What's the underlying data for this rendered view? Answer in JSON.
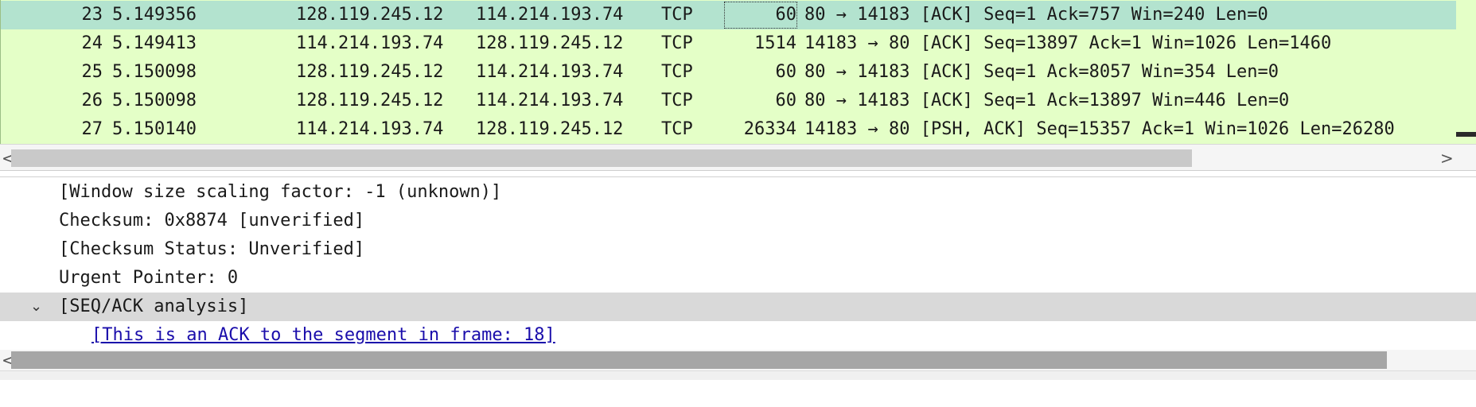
{
  "packet_list": {
    "rows": [
      {
        "no": "23",
        "time": "5.149356",
        "source": "128.119.245.12",
        "destination": "114.214.193.74",
        "protocol": "TCP",
        "length": "60",
        "info": "80 → 14183 [ACK] Seq=1 Ack=757 Win=240 Len=0",
        "selected": true
      },
      {
        "no": "24",
        "time": "5.149413",
        "source": "114.214.193.74",
        "destination": "128.119.245.12",
        "protocol": "TCP",
        "length": "1514",
        "info": "14183 → 80 [ACK] Seq=13897 Ack=1 Win=1026 Len=1460",
        "selected": false
      },
      {
        "no": "25",
        "time": "5.150098",
        "source": "128.119.245.12",
        "destination": "114.214.193.74",
        "protocol": "TCP",
        "length": "60",
        "info": "80 → 14183 [ACK] Seq=1 Ack=8057 Win=354 Len=0",
        "selected": false
      },
      {
        "no": "26",
        "time": "5.150098",
        "source": "128.119.245.12",
        "destination": "114.214.193.74",
        "protocol": "TCP",
        "length": "60",
        "info": "80 → 14183 [ACK] Seq=1 Ack=13897 Win=446 Len=0",
        "selected": false
      },
      {
        "no": "27",
        "time": "5.150140",
        "source": "114.214.193.74",
        "destination": "128.119.245.12",
        "protocol": "TCP",
        "length": "26334",
        "info": "14183 → 80 [PSH, ACK] Seq=15357 Ack=1 Win=1026 Len=26280",
        "selected": false
      }
    ],
    "row_bg": "#e4ffc7",
    "selected_bg": "#b3e3cf"
  },
  "scroll": {
    "left_arrow": "<",
    "right_arrow": ">"
  },
  "details": {
    "lines": [
      {
        "text": "[Window size scaling factor: -1 (unknown)]"
      },
      {
        "text": "Checksum: 0x8874 [unverified]"
      },
      {
        "text": "[Checksum Status: Unverified]"
      },
      {
        "text": "Urgent Pointer: 0"
      },
      {
        "text": "[SEQ/ACK analysis]",
        "expander": "⌄"
      },
      {
        "text": "[This is an ACK to the segment in frame: 18]"
      }
    ],
    "highlight_bg": "#d9d9d9",
    "link_color": "#1a0dab"
  }
}
